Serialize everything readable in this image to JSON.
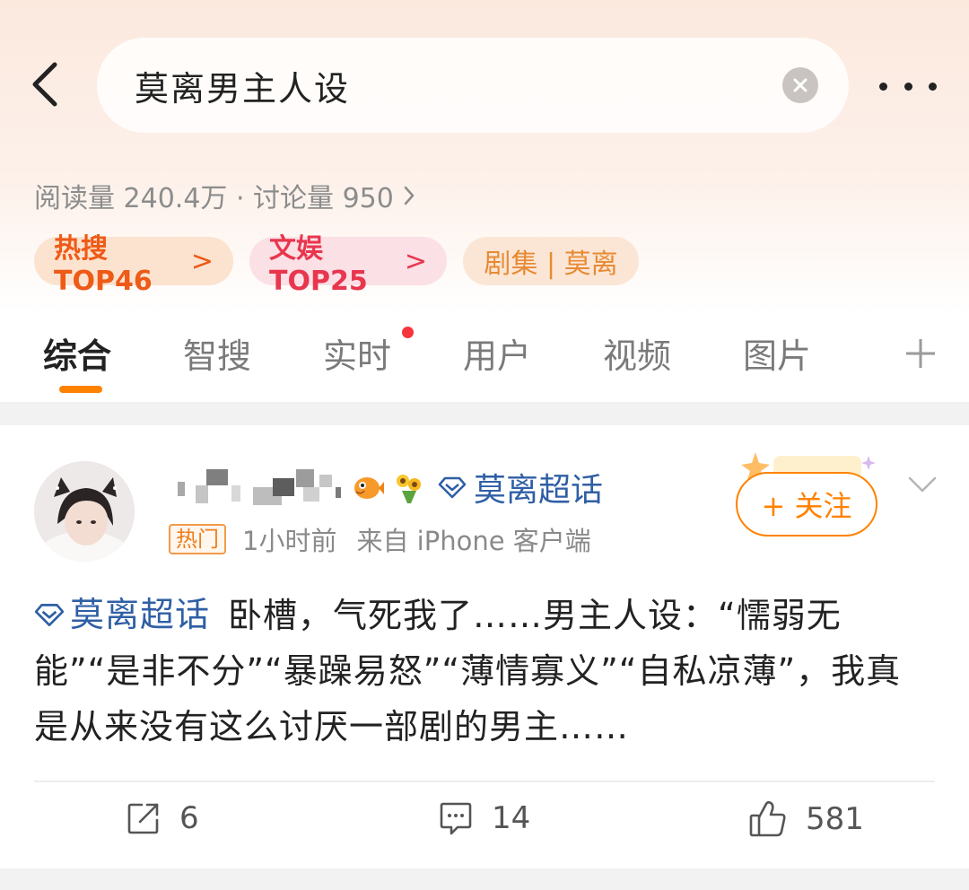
{
  "header": {
    "search_query": "莫离男主人设",
    "back_icon": "chevron-left-icon",
    "clear_icon": "close-icon",
    "more_icon": "more-icon"
  },
  "stats": {
    "text": "阅读量 240.4万 · 讨论量 950",
    "chevron": "›"
  },
  "chips": [
    {
      "label": "热搜TOP46",
      "suffix": ">",
      "color": "#ee5a17"
    },
    {
      "label": "文娱TOP25",
      "suffix": ">",
      "color": "#e8364e"
    },
    {
      "label": "剧集 | 莫离",
      "color": "#e88a33"
    }
  ],
  "tabs": [
    {
      "label": "综合",
      "active": true
    },
    {
      "label": "智搜"
    },
    {
      "label": "实时",
      "has_dot": true
    },
    {
      "label": "用户"
    },
    {
      "label": "视频"
    },
    {
      "label": "图片"
    }
  ],
  "post": {
    "topic_link": "莫离超话",
    "hot_badge": "热门",
    "time": "1小时前",
    "source": "来自 iPhone 客户端",
    "follow_label": "+ 关注",
    "body_topic": "莫离超话",
    "body_text": "卧槽，气死我了……男主人设：“懦弱无能”“是非不分”“暴躁易怒”“薄情寡义”“自私凉薄”，我真是从来没有这么讨厌一部剧的男主……",
    "repost_count": "6",
    "comment_count": "14",
    "like_count": "581"
  },
  "colors": {
    "accent": "#ff8200",
    "link": "#2f5fa5",
    "red_dot": "#f5353c"
  }
}
